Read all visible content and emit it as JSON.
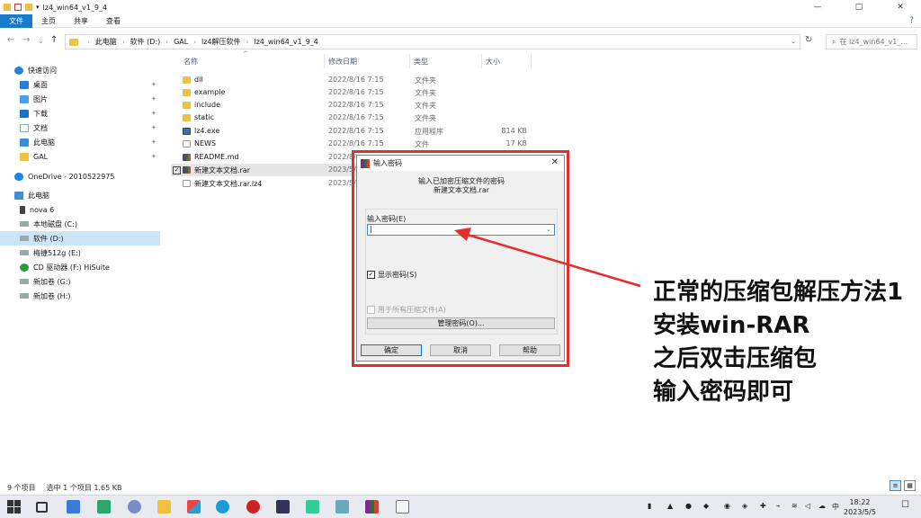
{
  "window": {
    "title": "lz4_win64_v1_9_4",
    "controls": {
      "minimize": "—",
      "maximize": "□",
      "close": "✕"
    }
  },
  "ribbon": {
    "tabs": [
      "文件",
      "主页",
      "共享",
      "查看"
    ],
    "help": "?"
  },
  "address": {
    "back": "←",
    "forward": "→",
    "recent": "⌄",
    "up": "↑",
    "crumbs": [
      "此电脑",
      "软件 (D:)",
      "GAL",
      "lz4解压软件",
      "lz4_win64_v1_9_4"
    ],
    "refresh": "↻",
    "search_placeholder": "在 lz4_win64_v1_..."
  },
  "sidebar": {
    "items": [
      {
        "label": "快速访问",
        "icon": "star-icon",
        "pinned": false
      },
      {
        "label": "桌面",
        "icon": "desktop-icon",
        "pinned": true
      },
      {
        "label": "图片",
        "icon": "pictures-icon",
        "pinned": true
      },
      {
        "label": "下载",
        "icon": "download-icon",
        "pinned": true
      },
      {
        "label": "文档",
        "icon": "documents-icon",
        "pinned": true
      },
      {
        "label": "此电脑",
        "icon": "pc-icon",
        "pinned": true
      },
      {
        "label": "GAL",
        "icon": "folder-icon",
        "pinned": true
      },
      {
        "label": "OneDrive - 2010522975",
        "icon": "onedrive-icon",
        "pinned": false
      },
      {
        "label": "此电脑",
        "icon": "pc-icon",
        "pinned": false
      },
      {
        "label": "nova 6",
        "icon": "phone-icon",
        "pinned": false
      },
      {
        "label": "本地磁盘 (C:)",
        "icon": "drive-icon",
        "pinned": false
      },
      {
        "label": "软件 (D:)",
        "icon": "drive-icon",
        "pinned": false
      },
      {
        "label": "梅捷512g (E:)",
        "icon": "drive-icon",
        "pinned": false
      },
      {
        "label": "CD 驱动器 (F:) HiSuite",
        "icon": "cd-icon",
        "pinned": false
      },
      {
        "label": "新加卷 (G:)",
        "icon": "drive-icon",
        "pinned": false
      },
      {
        "label": "新加卷 (H:)",
        "icon": "drive-icon",
        "pinned": false
      }
    ],
    "pin_glyph": "📌"
  },
  "filelist": {
    "columns": {
      "name": "名称",
      "date": "修改日期",
      "type": "类型",
      "size": "大小"
    },
    "sort_glyph": "^",
    "rows": [
      {
        "name": "dll",
        "date": "2022/8/16 7:15",
        "type": "文件夹",
        "size": "",
        "icon": "folder-icon"
      },
      {
        "name": "example",
        "date": "2022/8/16 7:15",
        "type": "文件夹",
        "size": "",
        "icon": "folder-icon"
      },
      {
        "name": "include",
        "date": "2022/8/16 7:15",
        "type": "文件夹",
        "size": "",
        "icon": "folder-icon"
      },
      {
        "name": "static",
        "date": "2022/8/16 7:15",
        "type": "文件夹",
        "size": "",
        "icon": "folder-icon"
      },
      {
        "name": "lz4.exe",
        "date": "2022/8/16 7:15",
        "type": "应用程序",
        "size": "814 KB",
        "icon": "exe-icon"
      },
      {
        "name": "NEWS",
        "date": "2022/8/16 7:15",
        "type": "文件",
        "size": "17 KB",
        "icon": "file-icon"
      },
      {
        "name": "README.md",
        "date": "2022/8/",
        "type": "",
        "size": "",
        "icon": "winrar-icon"
      },
      {
        "name": "新建文本文档.rar",
        "date": "2023/5/",
        "type": "",
        "size": "",
        "icon": "winrar-icon"
      },
      {
        "name": "新建文本文档.rar.lz4",
        "date": "2023/5/",
        "type": "",
        "size": "",
        "icon": "file-icon"
      }
    ],
    "checkbox_glyph": "✓"
  },
  "status": {
    "count": "9 个项目",
    "selection": "选中 1 个项目  1.65 KB"
  },
  "dialog": {
    "title": "输入密码",
    "close": "✕",
    "message_line1": "输入已加密压缩文件的密码",
    "message_line2": "新建文本文档.rar",
    "password_label": "输入密码(E)",
    "password_value": "|",
    "dropdown_glyph": "⌄",
    "show_password": "显示密码(S)",
    "show_password_checked": "✓",
    "use_for_all": "用于所有压缩文件(A)",
    "manage_button": "管理密码(O)...",
    "ok": "确定",
    "cancel": "取消",
    "help": "帮助"
  },
  "annotation": {
    "lines": [
      "正常的压缩包解压方法1",
      "安装win-RAR",
      "之后双击压缩包",
      "输入密码即可"
    ],
    "color": "#e52d2d"
  },
  "taskbar": {
    "tray_text": "中",
    "time": "18:22",
    "date": "2023/5/5"
  }
}
